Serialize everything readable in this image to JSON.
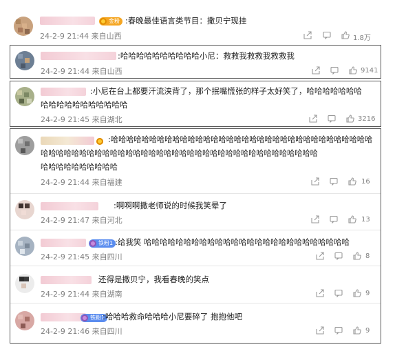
{
  "comments": [
    {
      "text": ":春晚最佳语言类节目：撒贝宁现挂",
      "time": "24-2-9 21:44",
      "location": "来自山西",
      "likes": "1.8万",
      "badge": "金粉"
    },
    {
      "text": ":哈哈哈哈哈哈哈哈哈哈小尼：救救我救救我救救我",
      "time": "24-2-9 21:44",
      "location": "来自山西",
      "likes": "9141",
      "badge": ""
    },
    {
      "text": ":小尼在台上都要汗流浃背了，那个抿嘴慌张的样子太好笑了，哈哈哈哈哈哈哈",
      "text2": "哈哈哈哈哈哈哈哈哈哈哈",
      "time": "24-2-9 21:45",
      "location": "来自湖北",
      "likes": "3216",
      "badge": ""
    },
    {
      "text": ":哈哈哈哈哈哈哈哈哈哈哈哈哈哈哈哈哈哈哈哈哈哈哈哈哈哈哈哈哈哈哈哈哈哈",
      "text2": "哈哈哈哈哈哈哈哈哈哈哈哈哈哈哈哈哈哈哈哈哈哈哈哈哈哈哈哈哈哈哈哈哈哈哈哈",
      "text3": "哈哈哈哈哈哈哈哈哈哈",
      "time": "24-2-9 21:44",
      "location": "来自福建",
      "likes": "16",
      "badge": ""
    },
    {
      "text": ":啊啊啊撒老师说的时候我笑晕了",
      "time": "24-2-9 21:47",
      "location": "来自河北",
      "likes": "13",
      "badge": ""
    },
    {
      "text": ":给我笑  哈哈哈哈哈哈哈哈哈哈哈哈哈哈哈哈哈哈哈哈哈哈哈哈哈哈",
      "time": "24-2-9 21:45",
      "location": "来自四川",
      "likes": "8",
      "badge": "铁粉1"
    },
    {
      "text": "还得是撒贝宁，我看春晚的笑点",
      "time": "24-2-9 21:44",
      "location": "来自湖南",
      "likes": "9",
      "badge": ""
    },
    {
      "text": ":哈哈哈救命哈哈哈小尼要碎了 抱抱他吧",
      "time": "24-2-9 21:46",
      "location": "来自四川",
      "likes": "9",
      "badge": "铁粉1"
    }
  ],
  "icons": {
    "share": "share-icon",
    "comment": "comment-icon",
    "like": "like-icon"
  }
}
